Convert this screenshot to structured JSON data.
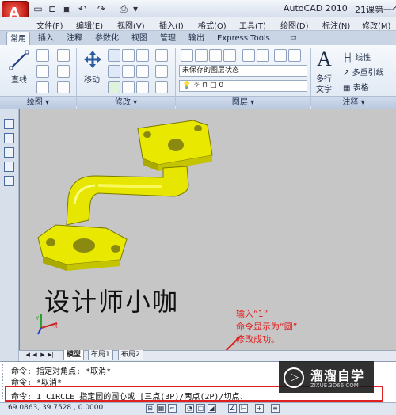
{
  "title_bar": {
    "app_title": "AutoCAD 2010",
    "doc_title": "21课第一个",
    "logo_letter": "A"
  },
  "quick_access": [
    "new-icon",
    "open-icon",
    "save-icon",
    "undo-icon",
    "redo-icon",
    "plot-icon"
  ],
  "menu": [
    "文件(F)",
    "编辑(E)",
    "视图(V)",
    "插入(I)",
    "格式(O)",
    "工具(T)",
    "绘图(D)",
    "标注(N)",
    "修改(M)"
  ],
  "ribbon_tabs": [
    "常用",
    "插入",
    "注释",
    "参数化",
    "视图",
    "管理",
    "输出",
    "Express Tools"
  ],
  "ribbon": {
    "draw": {
      "title": "绘图 ▾",
      "line_label": "直线"
    },
    "modify": {
      "title": "修改 ▾",
      "move_label": "移动"
    },
    "layers": {
      "title": "图层 ▾",
      "layer_state": "未保存的图层状态",
      "current_layer": "0"
    },
    "annotation": {
      "title": "注释 ▾",
      "mtext_label_1": "多行",
      "mtext_label_2": "文字",
      "linear_label": "线性",
      "mleader_label": "多重引线",
      "table_label": "表格"
    }
  },
  "viewport": {
    "model_text": "设计师小咖",
    "model_color": "#e8e800",
    "background": "#c6c6c6"
  },
  "layout_tabs": [
    "模型",
    "布局1",
    "布局2"
  ],
  "command_window": {
    "lines": [
      "命令: 指定对角点: *取消*",
      "命令: *取消*"
    ],
    "active_line": "命令: 1 CIRCLE 指定圆的圆心或 [三点(3P)/两点(2P)/切点、"
  },
  "annotation": {
    "lines": [
      "输入“1”",
      "命令显示为“圆”",
      "修改成功。"
    ],
    "color": "#e02020"
  },
  "status_bar": {
    "coordinates": "69.0863,   39.7528 , 0.0000"
  },
  "watermark": {
    "title": "溜溜自学",
    "subtitle": "ZIXUE.3D66.COM"
  }
}
